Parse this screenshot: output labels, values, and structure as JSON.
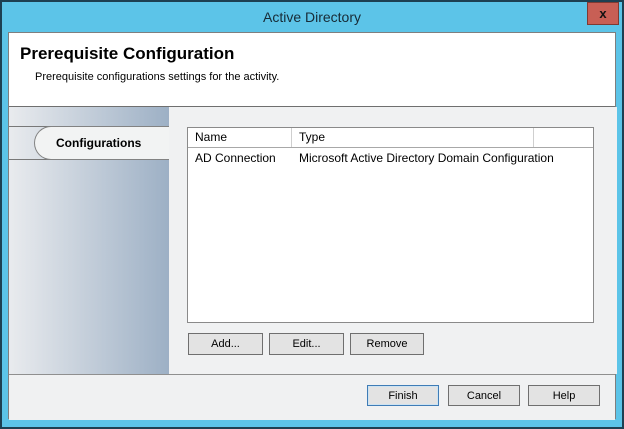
{
  "window": {
    "title": "Active Directory",
    "close_label": "x"
  },
  "header": {
    "title": "Prerequisite Configuration",
    "subtitle": "Prerequisite configurations settings for the activity."
  },
  "sidebar": {
    "tabs": [
      {
        "label": "Configurations",
        "selected": true
      }
    ]
  },
  "table": {
    "columns": [
      "Name",
      "Type"
    ],
    "rows": [
      {
        "name": "AD Connection",
        "type": "Microsoft Active Directory Domain Configuration"
      }
    ]
  },
  "actions": {
    "add": "Add...",
    "edit": "Edit...",
    "remove": "Remove"
  },
  "footer": {
    "finish": "Finish",
    "cancel": "Cancel",
    "help": "Help"
  },
  "colors": {
    "titlebar": "#5cc4e8",
    "frame_edge": "#1d4052",
    "close_fill": "#c85f55",
    "close_border": "#7e3a33",
    "sidebar_from": "#e9ebee",
    "sidebar_to": "#9db0c5",
    "accent_focus": "#3f7cb6"
  }
}
